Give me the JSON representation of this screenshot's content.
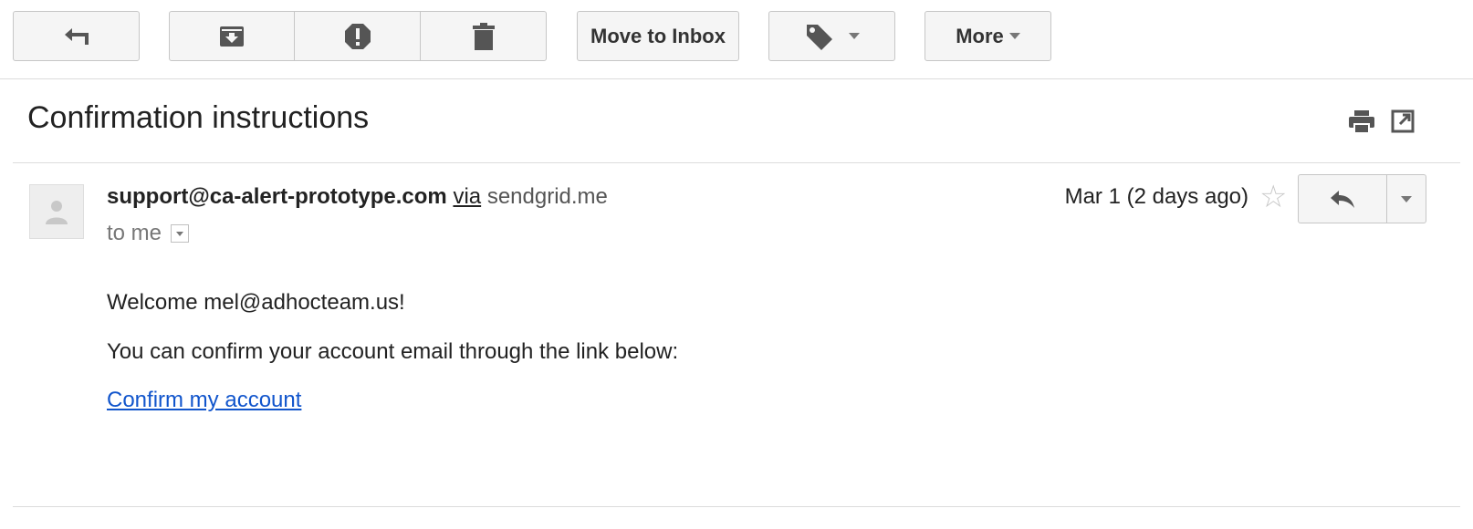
{
  "toolbar": {
    "back_icon": "back-arrow-icon",
    "archive_icon": "archive-icon",
    "spam_icon": "report-spam-icon",
    "delete_icon": "trash-icon",
    "move_to_inbox_label": "Move to Inbox",
    "labels_icon": "tag-icon",
    "more_label": "More"
  },
  "message": {
    "subject": "Confirmation instructions",
    "from": "support@ca-alert-prototype.com",
    "via_label": "via",
    "via_domain": "sendgrid.me",
    "to_label": "to me",
    "date": "Mar 1 (2 days ago)",
    "greeting": "Welcome mel@adhocteam.us!",
    "instructions": "You can confirm your account email through the link below:",
    "link_text": "Confirm my account"
  },
  "colors": {
    "link": "#1155cc",
    "button_bg": "#f5f5f5",
    "border": "#c6c6c6"
  }
}
